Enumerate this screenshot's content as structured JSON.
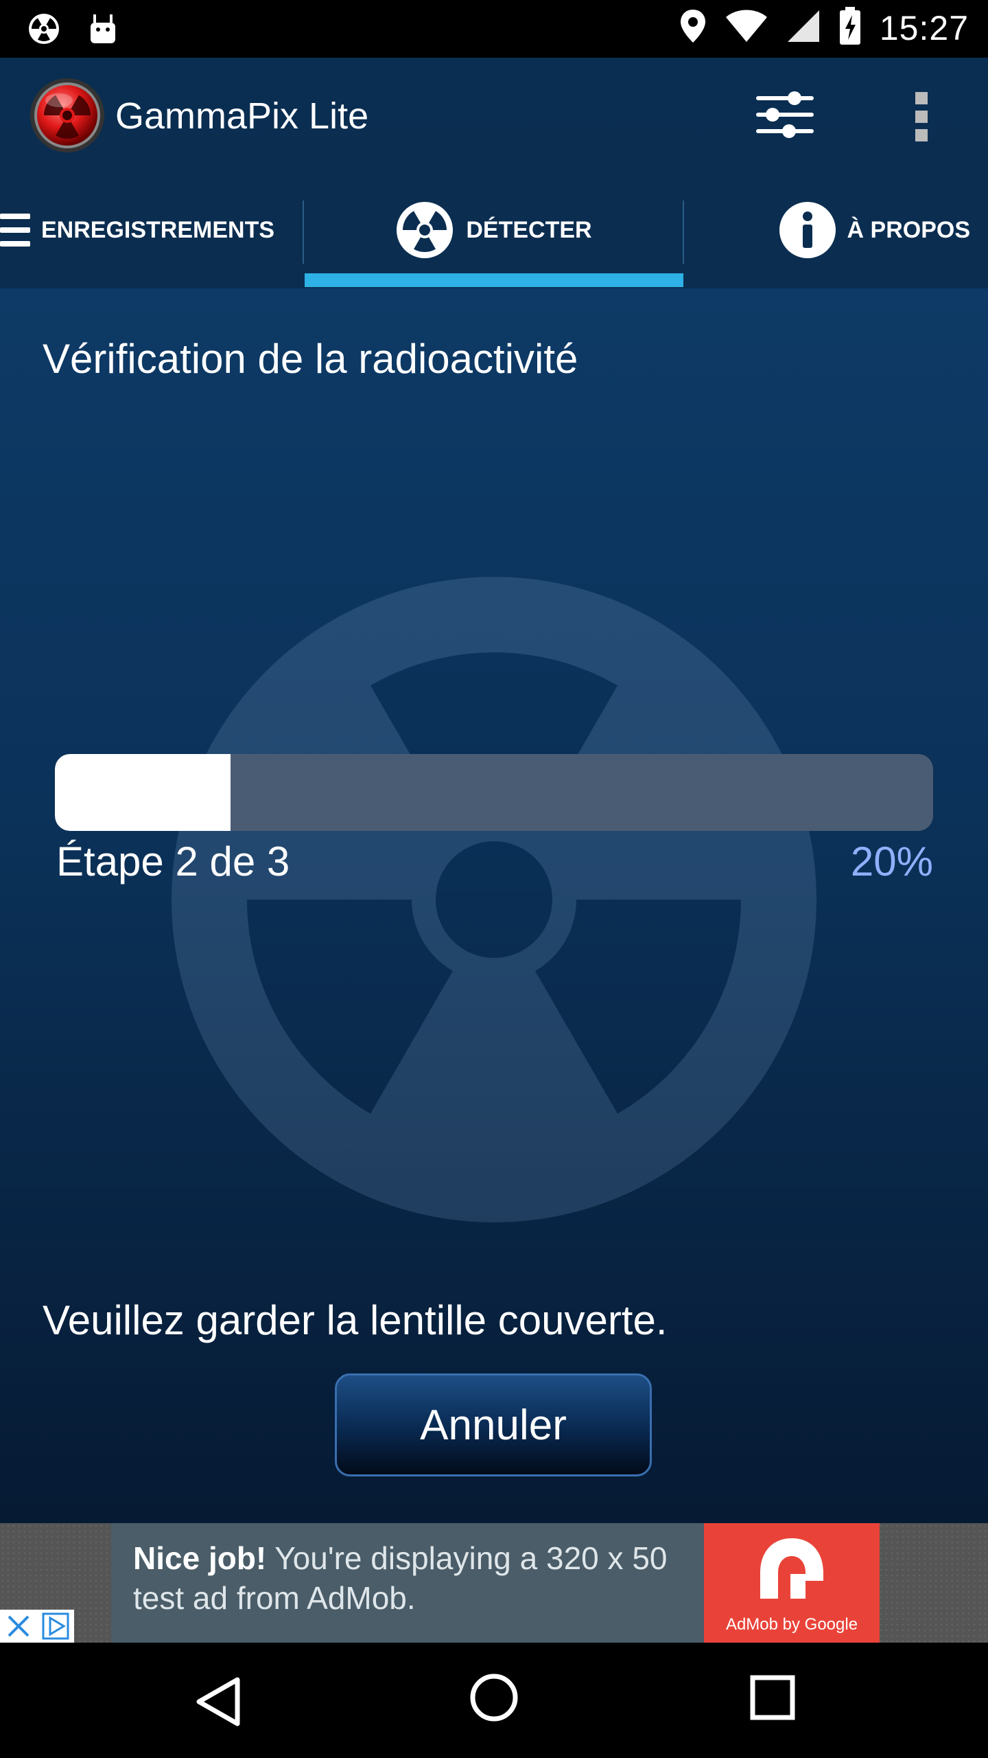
{
  "status_bar": {
    "time": "15:27",
    "left_icons": [
      "radiation-icon",
      "android-icon"
    ],
    "right_icons": [
      "location-icon",
      "wifi-icon",
      "signal-icon",
      "battery-charging-icon"
    ]
  },
  "app_bar": {
    "title": "GammaPix Lite",
    "logo_icon": "radiation-logo-icon",
    "actions": [
      "filter-sliders-icon",
      "overflow-menu-icon"
    ]
  },
  "tabs": [
    {
      "label": "ENREGISTREMENTS",
      "icon": "menu-lines-icon",
      "selected": false
    },
    {
      "label": "DÉTECTER",
      "icon": "radiation-icon",
      "selected": true
    },
    {
      "label": "À PROPOS",
      "icon": "info-icon",
      "selected": false
    }
  ],
  "main": {
    "heading": "Vérification de la radioactivité",
    "progress": {
      "step_text": "Étape 2 de 3",
      "percent_text": "20%",
      "fill_fraction": 0.2
    },
    "instruction": "Veuillez garder la lentille couverte.",
    "cancel_label": "Annuler"
  },
  "ad": {
    "headline": "Nice job!",
    "body": " You're displaying a 320 x 50 test ad from AdMob.",
    "brand": "AdMob by Google"
  },
  "colors": {
    "accent": "#2db1e6",
    "percent_text": "#8fb0ff",
    "app_bar": "#0b2d50",
    "ad_red": "#e94339"
  },
  "nav_bar": [
    "back-icon",
    "home-icon",
    "recents-icon"
  ]
}
